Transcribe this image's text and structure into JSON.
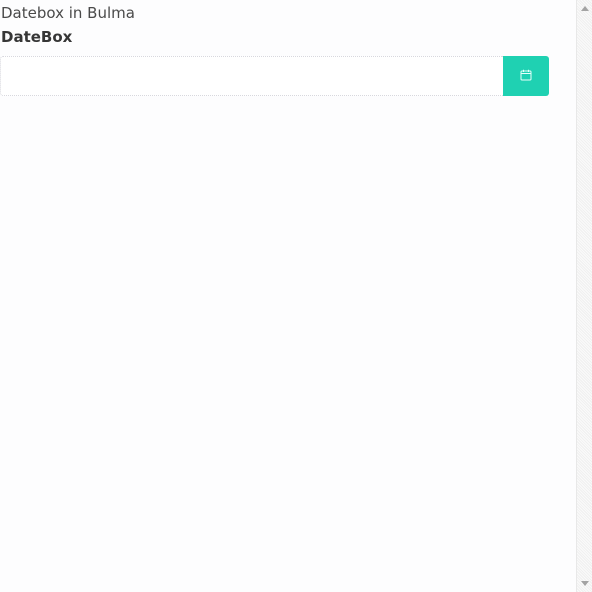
{
  "page": {
    "title": "Datebox in Bulma"
  },
  "datebox": {
    "label": "DateBox",
    "value": "",
    "placeholder": "",
    "button_icon": "calendar-icon",
    "accent_color": "#1fd1b2"
  }
}
